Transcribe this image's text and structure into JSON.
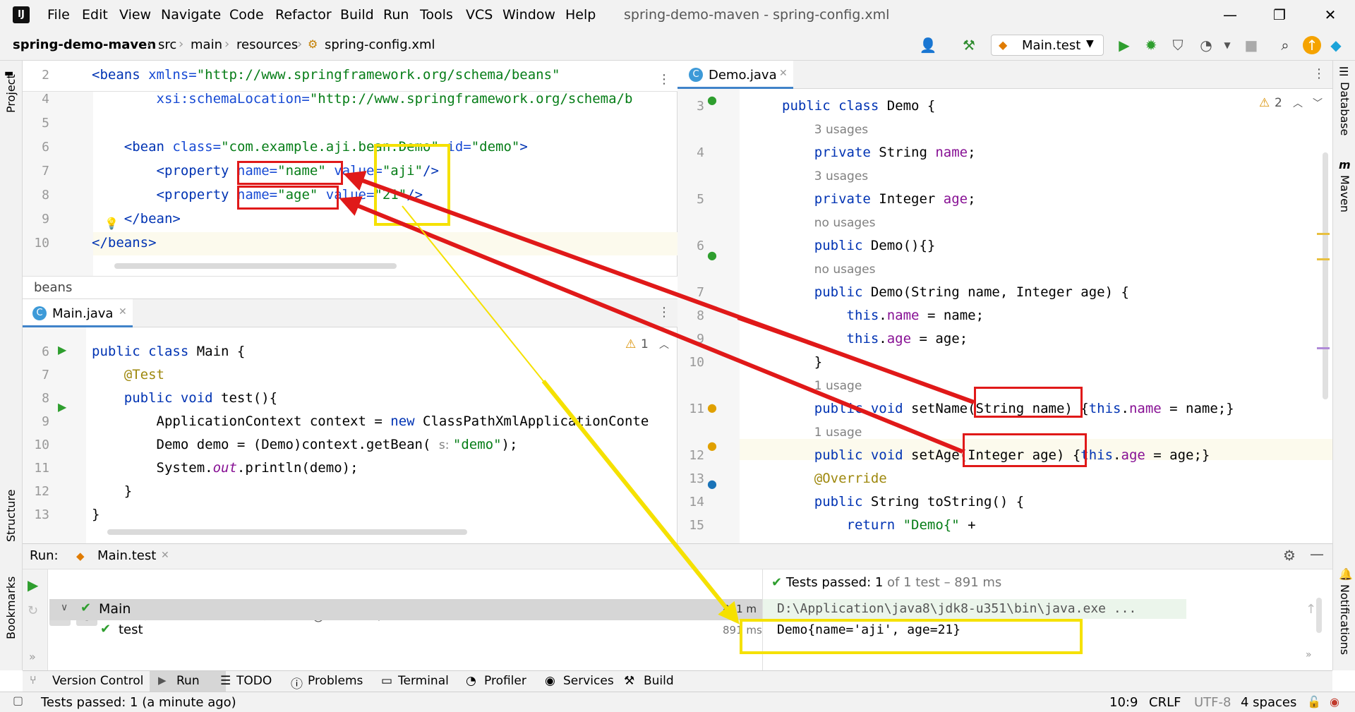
{
  "menu": [
    "File",
    "Edit",
    "View",
    "Navigate",
    "Code",
    "Refactor",
    "Build",
    "Run",
    "Tools",
    "VCS",
    "Window",
    "Help"
  ],
  "window_title": "spring-demo-maven - spring-config.xml",
  "breadcrumbs": [
    "spring-demo-maven",
    "src",
    "main",
    "resources",
    "spring-config.xml"
  ],
  "run_config": "Main.test",
  "left_strip": [
    "Project",
    "Structure",
    "Bookmarks"
  ],
  "right_strip": [
    "Database",
    "Maven",
    "Notifications"
  ],
  "xml_editor": {
    "lines": [
      {
        "n": "2",
        "html": "<span class=\"tag\">&lt;beans</span> <span class=\"attr\">xmlns=</span><span class=\"str\">\"http://www.springframework.org/schema/beans\"</span>"
      },
      {
        "n": "4",
        "html": "        <span class=\"attr\">xsi:schemaLocation=</span><span class=\"str\">\"http://www.springframework.org/schema/b</span>"
      },
      {
        "n": "5",
        "html": ""
      },
      {
        "n": "6",
        "html": "    <span class=\"tag\">&lt;bean</span> <span class=\"attr\">class=</span><span class=\"str\">\"com.example.aji.bean.Demo\"</span> <span class=\"attr\">id=</span><span class=\"str\">\"demo\"</span><span class=\"tag\">&gt;</span>"
      },
      {
        "n": "7",
        "html": "        <span class=\"tag\">&lt;property</span> <span class=\"attr\">name=</span><span class=\"str\">\"name\"</span> <span class=\"attr\">value=</span><span class=\"str\">\"aji\"</span><span class=\"tag\">/&gt;</span>"
      },
      {
        "n": "8",
        "html": "        <span class=\"tag\">&lt;property</span> <span class=\"attr\">name=</span><span class=\"str\">\"age\"</span> <span class=\"attr\">value=</span><span class=\"str\">\"21\"</span><span class=\"tag\">/&gt;</span>"
      },
      {
        "n": "9",
        "html": "    <span class=\"tag\">&lt;/bean&gt;</span>"
      },
      {
        "n": "10",
        "html": "<span class=\"tag\">&lt;/beans&gt;</span>"
      }
    ],
    "breadcrumb": "beans"
  },
  "main_tab": "Main.java",
  "main_warning": "1",
  "main_editor": {
    "lines": [
      {
        "n": "6",
        "html": "<span class=\"kw\">public class</span> Main {"
      },
      {
        "n": "7",
        "html": "    <span class=\"ann\">@Test</span>"
      },
      {
        "n": "8",
        "html": "    <span class=\"kw\">public void</span> test(){"
      },
      {
        "n": "9",
        "html": "        ApplicationContext context = <span class=\"kw\">new</span> ClassPathXmlApplicationConte"
      },
      {
        "n": "10",
        "html": "        Demo demo = (Demo)context.getBean( <span class=\"hint\">s: </span><span class=\"str\">\"demo\"</span>);"
      },
      {
        "n": "11",
        "html": "        System.<span class=\"field ital\">out</span>.println(demo);"
      },
      {
        "n": "12",
        "html": "    }"
      },
      {
        "n": "13",
        "html": "}"
      }
    ]
  },
  "demo_tab": "Demo.java",
  "demo_warning": "2",
  "demo_editor": {
    "lines": [
      {
        "n": "3",
        "html": "<span class=\"kw\">public class</span> Demo {"
      },
      {
        "n": "",
        "html": "    <span class=\"hint\">3 usages</span>"
      },
      {
        "n": "4",
        "html": "    <span class=\"kw\">private</span> String <span class=\"field\">name</span>;"
      },
      {
        "n": "",
        "html": "    <span class=\"hint\">3 usages</span>"
      },
      {
        "n": "5",
        "html": "    <span class=\"kw\">private</span> Integer <span class=\"field\">age</span>;"
      },
      {
        "n": "",
        "html": "    <span class=\"hint\">no usages</span>"
      },
      {
        "n": "6",
        "html": "    <span class=\"kw\">public</span> Demo(){}"
      },
      {
        "n": "",
        "html": "    <span class=\"hint\">no usages</span>"
      },
      {
        "n": "7",
        "html": "    <span class=\"kw\">public</span> Demo(String name, Integer age) {"
      },
      {
        "n": "8",
        "html": "        <span class=\"kw\">this</span>.<span class=\"field\">name</span> = name;"
      },
      {
        "n": "9",
        "html": "        <span class=\"kw\">this</span>.<span class=\"field\">age</span> = age;"
      },
      {
        "n": "10",
        "html": "    }"
      },
      {
        "n": "",
        "html": "    <span class=\"hint\">1 usage</span>"
      },
      {
        "n": "11",
        "html": "    <span class=\"kw\">public void</span> setName(String name) {<span class=\"kw\">this</span>.<span class=\"field\">name</span> = name;}"
      },
      {
        "n": "",
        "html": "    <span class=\"hint\">1 usage</span>"
      },
      {
        "n": "12",
        "html": "    <span class=\"kw\">public void</span> setAge(Integer age) {<span class=\"kw\">this</span>.<span class=\"field\">age</span> = age;}"
      },
      {
        "n": "13",
        "html": "    <span class=\"ann\">@Override</span>"
      },
      {
        "n": "14",
        "html": "    <span class=\"kw\">public</span> String toString() {"
      },
      {
        "n": "15",
        "html": "        <span class=\"kw\">return</span> <span class=\"str\">\"Demo{\"</span> +"
      }
    ]
  },
  "run": {
    "label": "Run:",
    "tab": "Main.test",
    "tree_root": "Main",
    "tree_root_time": "891 m",
    "tree_child": "test",
    "tree_child_time": "891 ms",
    "tests_passed_label": "Tests passed: ",
    "tests_passed_count": "1",
    "tests_passed_rest": " of 1 test – 891 ms",
    "console_cmd": "D:\\Application\\java8\\jdk8-u351\\bin\\java.exe ...",
    "console_output": "Demo{name='aji', age=21}"
  },
  "tool_tabs": [
    "Version Control",
    "Run",
    "TODO",
    "Problems",
    "Terminal",
    "Profiler",
    "Services",
    "Build"
  ],
  "status": {
    "message": "Tests passed: 1 (a minute ago)",
    "position": "10:9",
    "line_sep": "CRLF",
    "encoding": "UTF-8",
    "indent": "4 spaces"
  }
}
